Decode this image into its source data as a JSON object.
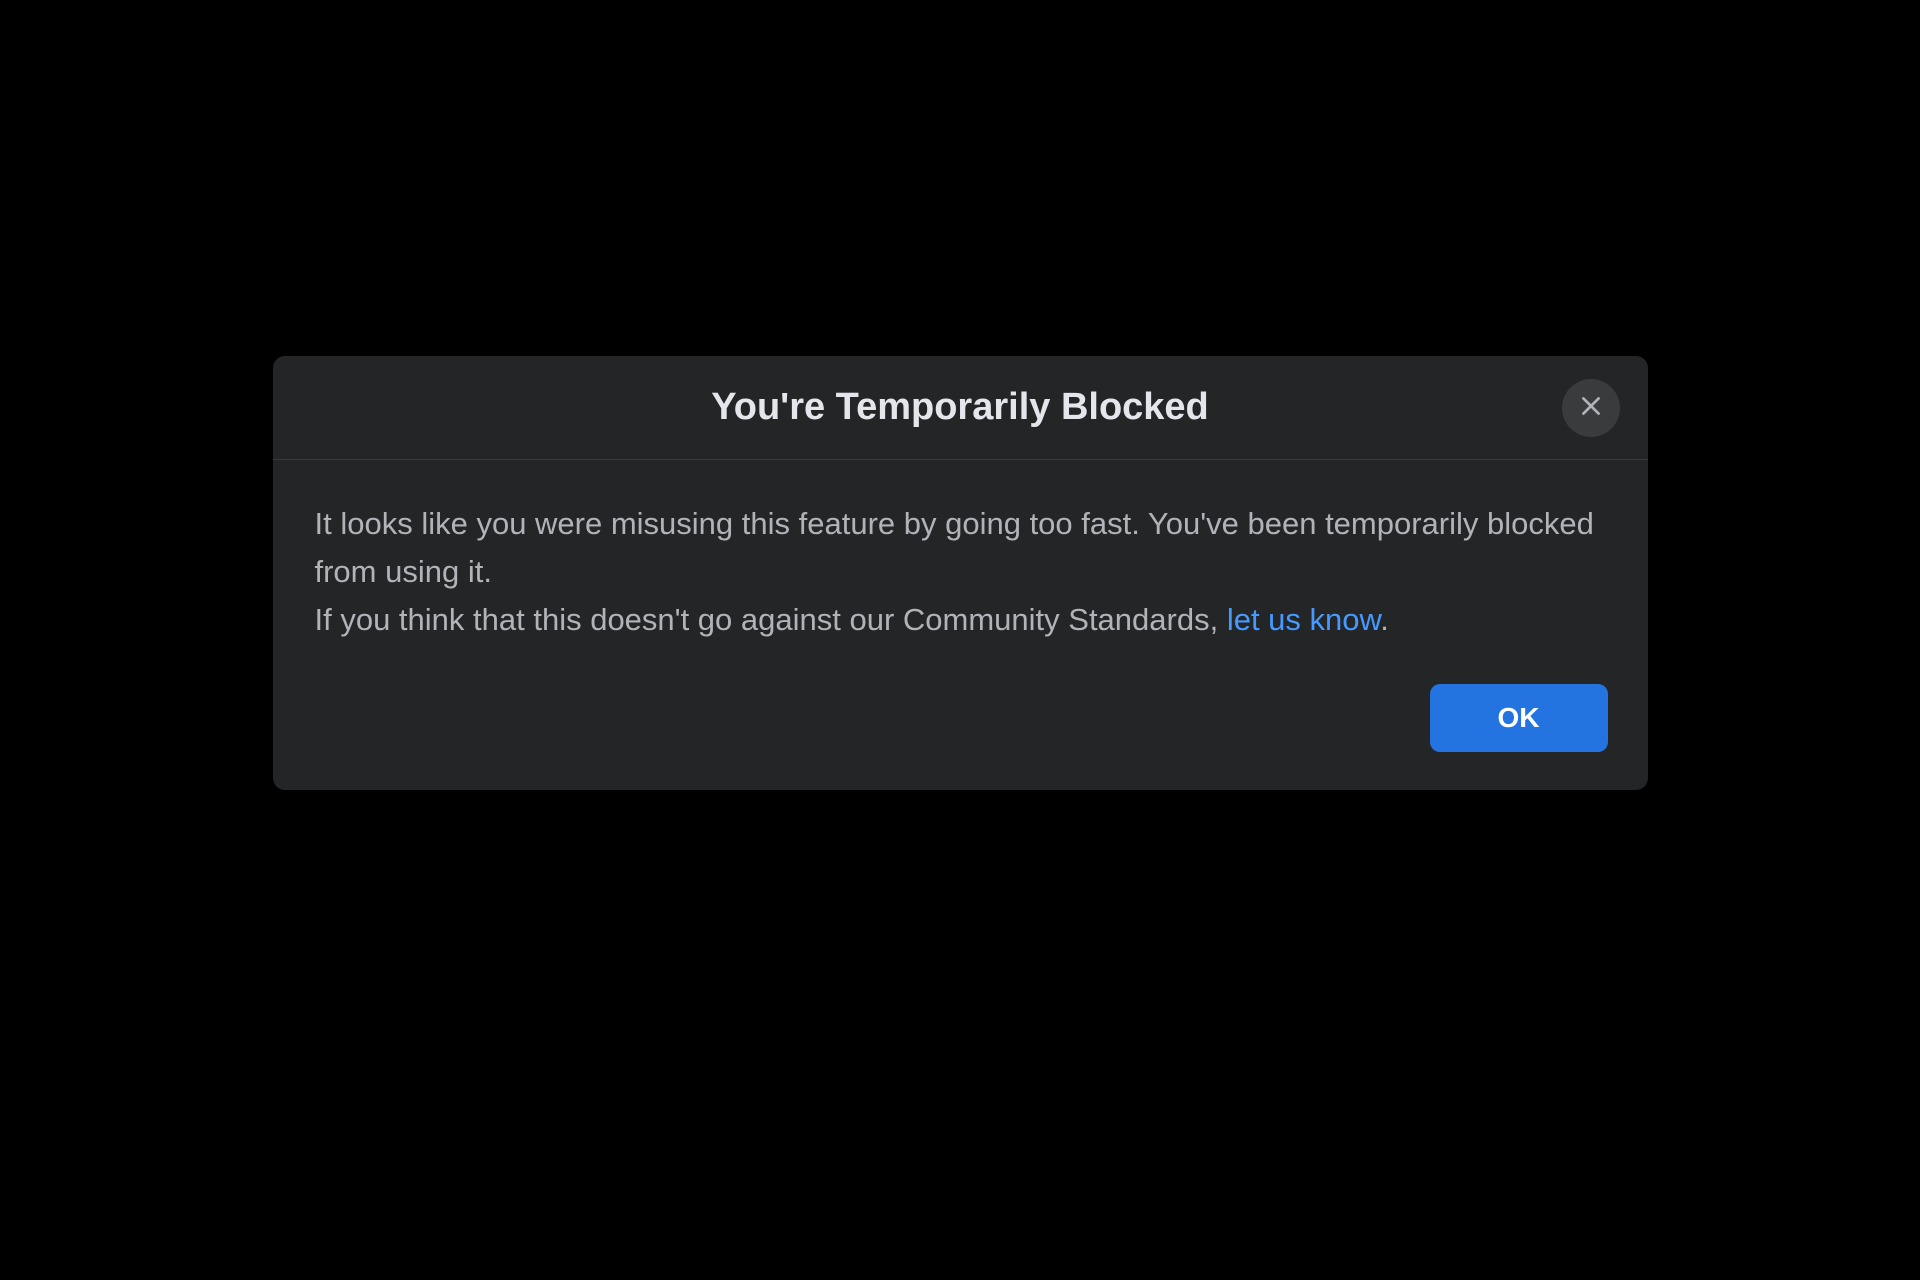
{
  "modal": {
    "title": "You're Temporarily Blocked",
    "body_line1": "It looks like you were misusing this feature by going too fast. You've been temporarily blocked from using it.",
    "body_line2_prefix": "If you think that this doesn't go against our Community Standards, ",
    "link_text": "let us know",
    "body_line2_suffix": ".",
    "ok_label": "OK"
  }
}
